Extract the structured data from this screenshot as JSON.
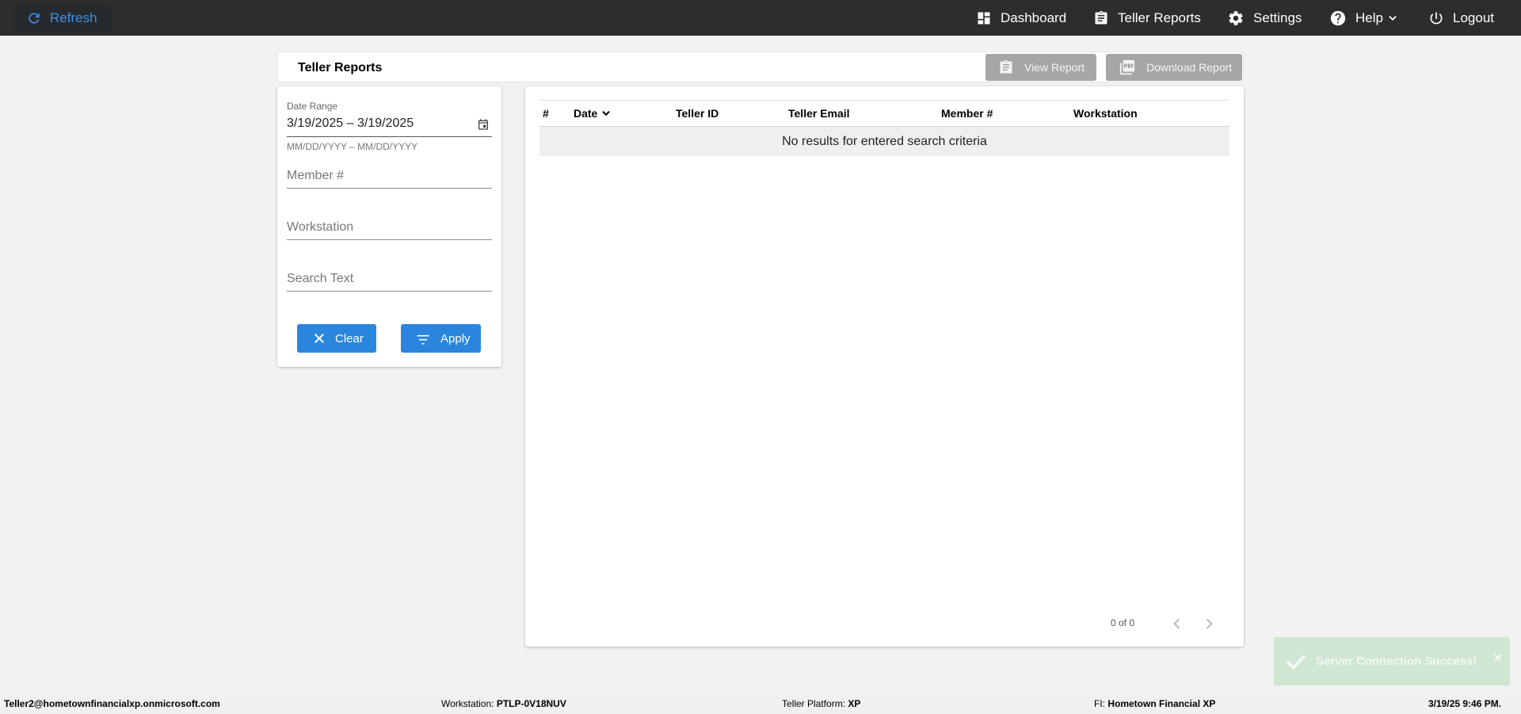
{
  "topbar": {
    "refresh_label": "Refresh",
    "nav": [
      {
        "label": "Dashboard",
        "icon": "dashboard-icon"
      },
      {
        "label": "Teller Reports",
        "icon": "clipboard-icon"
      },
      {
        "label": "Settings",
        "icon": "gear-icon"
      },
      {
        "label": "Help",
        "icon": "help-icon"
      },
      {
        "label": "Logout",
        "icon": "power-icon"
      }
    ]
  },
  "header": {
    "title": "Teller Reports",
    "view_report_label": "View Report",
    "download_report_label": "Download Report"
  },
  "filters": {
    "date_range_label": "Date Range",
    "date_range_value": "3/19/2025 – 3/19/2025",
    "date_range_hint": "MM/DD/YYYY – MM/DD/YYYY",
    "member_placeholder": "Member #",
    "workstation_placeholder": "Workstation",
    "search_placeholder": "Search Text",
    "clear_label": "Clear",
    "apply_label": "Apply"
  },
  "table": {
    "columns": [
      "#",
      "Date",
      "Teller ID",
      "Teller Email",
      "Member #",
      "Workstation"
    ],
    "empty_message": "No results for entered search criteria",
    "pager_text": "0 of 0"
  },
  "toast": {
    "message": "Server Connection Success!",
    "close": "×"
  },
  "status": {
    "user": "Teller2@hometownfinancialxp.onmicrosoft.com",
    "workstation_label": "Workstation:",
    "workstation_value": "PTLP-0V18NUV",
    "platform_label": "Teller Platform:",
    "platform_value": "XP",
    "fi_label": "FI:",
    "fi_value": "Hometown Financial XP",
    "datetime": "3/19/25 9:46 PM."
  },
  "colors": {
    "topbar": "#2d2d2d",
    "accent": "#2a86dd",
    "refresh_text": "#3d8fe0",
    "disabled_button": "#a6a6a6",
    "toast": "#cfe6d2"
  }
}
